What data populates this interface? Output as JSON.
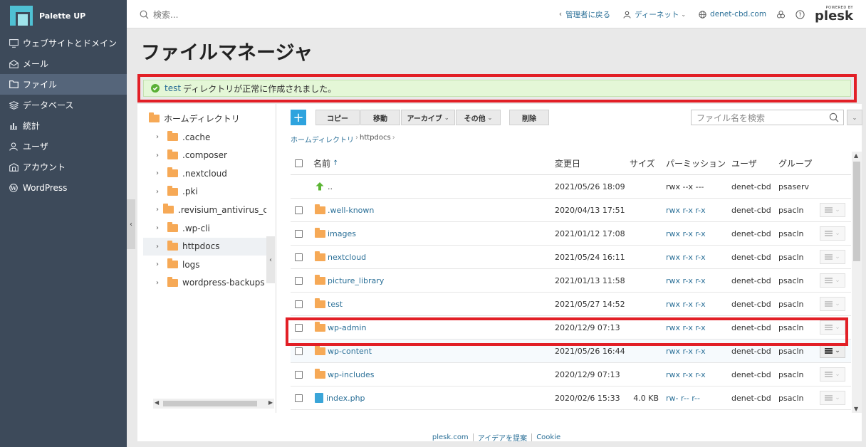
{
  "brand": {
    "name": "Palette UP"
  },
  "sidebar": {
    "items": [
      {
        "label": "ウェブサイトとドメイン",
        "icon": "monitor-icon",
        "active": false
      },
      {
        "label": "メール",
        "icon": "mail-icon",
        "active": false
      },
      {
        "label": "ファイル",
        "icon": "folder-icon",
        "active": true
      },
      {
        "label": "データベース",
        "icon": "database-icon",
        "active": false
      },
      {
        "label": "統計",
        "icon": "chart-icon",
        "active": false
      },
      {
        "label": "ユーザ",
        "icon": "user-icon",
        "active": false
      },
      {
        "label": "アカウント",
        "icon": "account-icon",
        "active": false
      },
      {
        "label": "WordPress",
        "icon": "wordpress-icon",
        "active": false
      }
    ]
  },
  "topbar": {
    "search_placeholder": "検索...",
    "back_to_admin": "管理者に戻る",
    "customer": "ディーネット",
    "domain": "denet-cbd.com",
    "powered_by": "POWERED BY",
    "plesk": "plesk"
  },
  "page": {
    "title": "ファイルマネージャ"
  },
  "alert": {
    "link_text": "test",
    "message": "ディレクトリが正常に作成されました。"
  },
  "tree": {
    "root": "ホームディレクトリ",
    "items": [
      {
        "label": ".cache",
        "active": false
      },
      {
        "label": ".composer",
        "active": false
      },
      {
        "label": ".nextcloud",
        "active": false
      },
      {
        "label": ".pki",
        "active": false
      },
      {
        "label": ".revisium_antivirus_cache",
        "active": false
      },
      {
        "label": ".wp-cli",
        "active": false
      },
      {
        "label": "httpdocs",
        "active": true
      },
      {
        "label": "logs",
        "active": false
      },
      {
        "label": "wordpress-backups",
        "active": false
      }
    ]
  },
  "toolbar": {
    "add": "+",
    "copy": "コピー",
    "move": "移動",
    "archive": "アーカイブ",
    "other": "その他",
    "delete": "削除",
    "search_placeholder": "ファイル名を検索"
  },
  "breadcrumb": {
    "home": "ホームディレクトリ",
    "current": "httpdocs"
  },
  "table": {
    "headers": {
      "name": "名前",
      "sort_arrow": "↑",
      "date": "変更日",
      "size": "サイズ",
      "perm": "パーミッション",
      "user": "ユーザ",
      "group": "グループ"
    },
    "rows": [
      {
        "name": "..",
        "type": "up",
        "date": "2021/05/26 18:09",
        "size": "",
        "perm": "rwx --x ---",
        "perm_link": false,
        "user": "denet-cbd",
        "group": "psaserv",
        "checkbox": false,
        "action": false
      },
      {
        "name": ".well-known",
        "type": "folder",
        "date": "2020/04/13 17:51",
        "size": "",
        "perm": "rwx r-x r-x",
        "perm_link": true,
        "user": "denet-cbd",
        "group": "psacln",
        "checkbox": true,
        "action": true
      },
      {
        "name": "images",
        "type": "folder",
        "date": "2021/01/12 17:08",
        "size": "",
        "perm": "rwx r-x r-x",
        "perm_link": true,
        "user": "denet-cbd",
        "group": "psacln",
        "checkbox": true,
        "action": true
      },
      {
        "name": "nextcloud",
        "type": "folder",
        "date": "2021/05/24 16:11",
        "size": "",
        "perm": "rwx r-x r-x",
        "perm_link": true,
        "user": "denet-cbd",
        "group": "psacln",
        "checkbox": true,
        "action": true
      },
      {
        "name": "picture_library",
        "type": "folder",
        "date": "2021/01/13 11:58",
        "size": "",
        "perm": "rwx r-x r-x",
        "perm_link": true,
        "user": "denet-cbd",
        "group": "psacln",
        "checkbox": true,
        "action": true
      },
      {
        "name": "test",
        "type": "folder",
        "date": "2021/05/27 14:52",
        "size": "",
        "perm": "rwx r-x r-x",
        "perm_link": true,
        "user": "denet-cbd",
        "group": "psacln",
        "checkbox": true,
        "action": true
      },
      {
        "name": "wp-admin",
        "type": "folder",
        "date": "2020/12/9 07:13",
        "size": "",
        "perm": "rwx r-x r-x",
        "perm_link": true,
        "user": "denet-cbd",
        "group": "psacln",
        "checkbox": true,
        "action": true
      },
      {
        "name": "wp-content",
        "type": "folder",
        "date": "2021/05/26 16:44",
        "size": "",
        "perm": "rwx r-x r-x",
        "perm_link": true,
        "user": "denet-cbd",
        "group": "psacln",
        "checkbox": true,
        "action": true,
        "hover": true
      },
      {
        "name": "wp-includes",
        "type": "folder",
        "date": "2020/12/9 07:13",
        "size": "",
        "perm": "rwx r-x r-x",
        "perm_link": true,
        "user": "denet-cbd",
        "group": "psacln",
        "checkbox": true,
        "action": true
      },
      {
        "name": "index.php",
        "type": "file",
        "date": "2020/02/6 15:33",
        "size": "4.0 KB",
        "perm": "rw- r-- r--",
        "perm_link": true,
        "user": "denet-cbd",
        "group": "psacln",
        "checkbox": true,
        "action": true
      }
    ]
  },
  "footer": {
    "link1": "plesk.com",
    "link2": "アイデアを提案",
    "link3": "Cookie"
  },
  "colors": {
    "sidebar": "#3d4a5a",
    "accent": "#2ea3de",
    "link": "#2a6f97",
    "highlight": "#e21f26",
    "success_bg": "#e4f7d7"
  }
}
